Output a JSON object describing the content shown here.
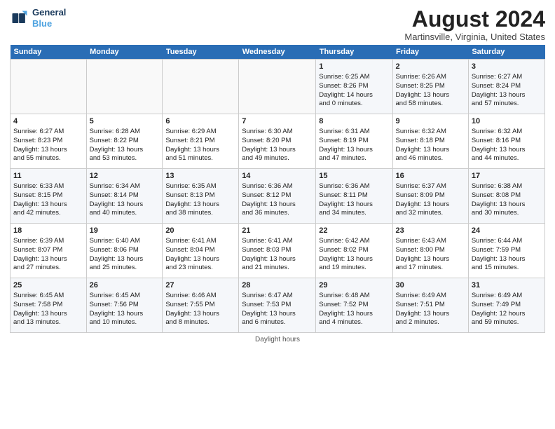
{
  "logo": {
    "line1": "General",
    "line2": "Blue"
  },
  "title": "August 2024",
  "location": "Martinsville, Virginia, United States",
  "days_header": [
    "Sunday",
    "Monday",
    "Tuesday",
    "Wednesday",
    "Thursday",
    "Friday",
    "Saturday"
  ],
  "footer": "Daylight hours",
  "weeks": [
    [
      {
        "day": "",
        "content": ""
      },
      {
        "day": "",
        "content": ""
      },
      {
        "day": "",
        "content": ""
      },
      {
        "day": "",
        "content": ""
      },
      {
        "day": "1",
        "content": "Sunrise: 6:25 AM\nSunset: 8:26 PM\nDaylight: 14 hours\nand 0 minutes."
      },
      {
        "day": "2",
        "content": "Sunrise: 6:26 AM\nSunset: 8:25 PM\nDaylight: 13 hours\nand 58 minutes."
      },
      {
        "day": "3",
        "content": "Sunrise: 6:27 AM\nSunset: 8:24 PM\nDaylight: 13 hours\nand 57 minutes."
      }
    ],
    [
      {
        "day": "4",
        "content": "Sunrise: 6:27 AM\nSunset: 8:23 PM\nDaylight: 13 hours\nand 55 minutes."
      },
      {
        "day": "5",
        "content": "Sunrise: 6:28 AM\nSunset: 8:22 PM\nDaylight: 13 hours\nand 53 minutes."
      },
      {
        "day": "6",
        "content": "Sunrise: 6:29 AM\nSunset: 8:21 PM\nDaylight: 13 hours\nand 51 minutes."
      },
      {
        "day": "7",
        "content": "Sunrise: 6:30 AM\nSunset: 8:20 PM\nDaylight: 13 hours\nand 49 minutes."
      },
      {
        "day": "8",
        "content": "Sunrise: 6:31 AM\nSunset: 8:19 PM\nDaylight: 13 hours\nand 47 minutes."
      },
      {
        "day": "9",
        "content": "Sunrise: 6:32 AM\nSunset: 8:18 PM\nDaylight: 13 hours\nand 46 minutes."
      },
      {
        "day": "10",
        "content": "Sunrise: 6:32 AM\nSunset: 8:16 PM\nDaylight: 13 hours\nand 44 minutes."
      }
    ],
    [
      {
        "day": "11",
        "content": "Sunrise: 6:33 AM\nSunset: 8:15 PM\nDaylight: 13 hours\nand 42 minutes."
      },
      {
        "day": "12",
        "content": "Sunrise: 6:34 AM\nSunset: 8:14 PM\nDaylight: 13 hours\nand 40 minutes."
      },
      {
        "day": "13",
        "content": "Sunrise: 6:35 AM\nSunset: 8:13 PM\nDaylight: 13 hours\nand 38 minutes."
      },
      {
        "day": "14",
        "content": "Sunrise: 6:36 AM\nSunset: 8:12 PM\nDaylight: 13 hours\nand 36 minutes."
      },
      {
        "day": "15",
        "content": "Sunrise: 6:36 AM\nSunset: 8:11 PM\nDaylight: 13 hours\nand 34 minutes."
      },
      {
        "day": "16",
        "content": "Sunrise: 6:37 AM\nSunset: 8:09 PM\nDaylight: 13 hours\nand 32 minutes."
      },
      {
        "day": "17",
        "content": "Sunrise: 6:38 AM\nSunset: 8:08 PM\nDaylight: 13 hours\nand 30 minutes."
      }
    ],
    [
      {
        "day": "18",
        "content": "Sunrise: 6:39 AM\nSunset: 8:07 PM\nDaylight: 13 hours\nand 27 minutes."
      },
      {
        "day": "19",
        "content": "Sunrise: 6:40 AM\nSunset: 8:06 PM\nDaylight: 13 hours\nand 25 minutes."
      },
      {
        "day": "20",
        "content": "Sunrise: 6:41 AM\nSunset: 8:04 PM\nDaylight: 13 hours\nand 23 minutes."
      },
      {
        "day": "21",
        "content": "Sunrise: 6:41 AM\nSunset: 8:03 PM\nDaylight: 13 hours\nand 21 minutes."
      },
      {
        "day": "22",
        "content": "Sunrise: 6:42 AM\nSunset: 8:02 PM\nDaylight: 13 hours\nand 19 minutes."
      },
      {
        "day": "23",
        "content": "Sunrise: 6:43 AM\nSunset: 8:00 PM\nDaylight: 13 hours\nand 17 minutes."
      },
      {
        "day": "24",
        "content": "Sunrise: 6:44 AM\nSunset: 7:59 PM\nDaylight: 13 hours\nand 15 minutes."
      }
    ],
    [
      {
        "day": "25",
        "content": "Sunrise: 6:45 AM\nSunset: 7:58 PM\nDaylight: 13 hours\nand 13 minutes."
      },
      {
        "day": "26",
        "content": "Sunrise: 6:45 AM\nSunset: 7:56 PM\nDaylight: 13 hours\nand 10 minutes."
      },
      {
        "day": "27",
        "content": "Sunrise: 6:46 AM\nSunset: 7:55 PM\nDaylight: 13 hours\nand 8 minutes."
      },
      {
        "day": "28",
        "content": "Sunrise: 6:47 AM\nSunset: 7:53 PM\nDaylight: 13 hours\nand 6 minutes."
      },
      {
        "day": "29",
        "content": "Sunrise: 6:48 AM\nSunset: 7:52 PM\nDaylight: 13 hours\nand 4 minutes."
      },
      {
        "day": "30",
        "content": "Sunrise: 6:49 AM\nSunset: 7:51 PM\nDaylight: 13 hours\nand 2 minutes."
      },
      {
        "day": "31",
        "content": "Sunrise: 6:49 AM\nSunset: 7:49 PM\nDaylight: 12 hours\nand 59 minutes."
      }
    ]
  ]
}
